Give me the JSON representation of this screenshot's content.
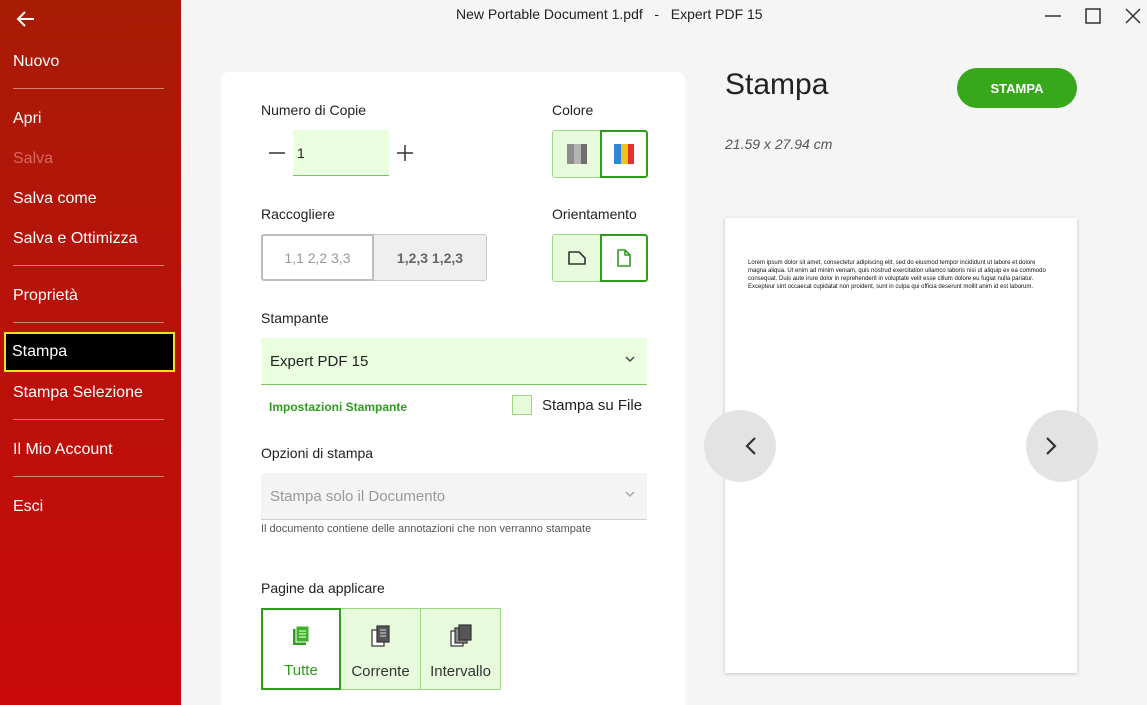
{
  "window": {
    "title": "New Portable Document 1.pdf   -   Expert PDF 15"
  },
  "sidebar": {
    "items": [
      {
        "label": "Nuovo"
      },
      {
        "label": "Apri"
      },
      {
        "label": "Salva"
      },
      {
        "label": "Salva come"
      },
      {
        "label": "Salva e Ottimizza"
      },
      {
        "label": "Proprietà"
      },
      {
        "label": "Stampa"
      },
      {
        "label": "Stampa Selezione"
      },
      {
        "label": "Il Mio Account"
      },
      {
        "label": "Esci"
      }
    ],
    "active_item": "Stampa",
    "disabled_item": "Salva",
    "colors": {
      "top": "#a81c06",
      "bottom": "#c80a0a",
      "active_bg": "#000000",
      "active_border": "#f2e31a"
    }
  },
  "copies": {
    "label": "Numero di Copie",
    "value": "1"
  },
  "color": {
    "label": "Colore",
    "options": [
      "grayscale-icon",
      "color-icon"
    ],
    "selected": "color-icon"
  },
  "collate": {
    "label": "Raccogliere",
    "option_uncollated": "1,1 2,2 3,3",
    "option_collated": "1,2,3 1,2,3"
  },
  "orientation": {
    "label": "Orientamento",
    "options": [
      "landscape-icon",
      "portrait-icon"
    ],
    "selected": "portrait-icon"
  },
  "printer": {
    "label": "Stampante",
    "selected": "Expert PDF 15",
    "settings_link": "Impostazioni Stampante",
    "print_to_file_label": "Stampa su File",
    "print_to_file_checked": false
  },
  "print_options": {
    "label": "Opzioni di stampa",
    "selected": "Stampa solo il Documento",
    "hint": "Il documento contiene delle annotazioni che non verranno stampate"
  },
  "pages": {
    "label": "Pagine da applicare",
    "options": [
      {
        "label": "Tutte",
        "icon": "all-pages-icon"
      },
      {
        "label": "Corrente",
        "icon": "current-page-icon"
      },
      {
        "label": "Intervallo",
        "icon": "page-range-icon"
      }
    ],
    "selected": "Tutte"
  },
  "preview": {
    "heading": "Stampa",
    "print_button": "STAMPA",
    "page_size": "21.59 x 27.94 cm",
    "page_text": "Lorem ipsum dolor sit amet, consectetur adipiscing elit, sed do eiusmod tempor incididunt ut labore et dolore magna aliqua. Ut enim ad minim veniam, quis nostrud exercitation ullamco laboris nisi ut aliquip ex ea commodo consequat. Duis aute irure dolor in reprehenderit in voluptate velit esse cillum dolore eu fugiat nulla pariatur. Excepteur sint occaecat cupidatat non proident, sunt in culpa qui officia deserunt mollit anim id est laborum."
  },
  "accent_color": "#37a81b"
}
